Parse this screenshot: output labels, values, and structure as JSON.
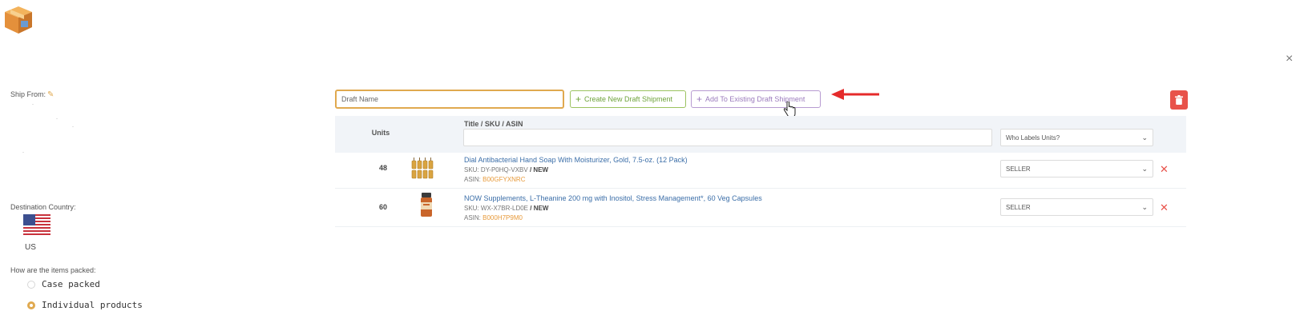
{
  "window": {
    "close_symbol": "×"
  },
  "left_panel": {
    "ship_from_label": "Ship From:",
    "destination_label": "Destination Country:",
    "country": "US",
    "packed_question": "How are the items packed:",
    "pack_options": [
      {
        "label": "Case packed",
        "selected": false
      },
      {
        "label": "Individual products",
        "selected": true
      }
    ]
  },
  "toolbar": {
    "draft_name_placeholder": "Draft Name",
    "create_label": "Create New Draft Shipment",
    "add_existing_label": "Add To Existing Draft Shipment",
    "plus": "+"
  },
  "table": {
    "headers": {
      "units": "Units",
      "title": "Title / SKU / ASIN"
    },
    "who_labels_placeholder": "Who Labels Units?",
    "rows": [
      {
        "units": "48",
        "title": "Dial Antibacterial Hand Soap With Moisturizer, Gold, 7.5-oz. (12 Pack)",
        "sku_prefix": "SKU: DY-P0HQ-VXBV",
        "condition": "/ NEW",
        "asin_prefix": "ASIN:",
        "asin": "B00GFYXNRC",
        "labels": "SELLER",
        "remove": "✕"
      },
      {
        "units": "60",
        "title": "NOW Supplements, L-Theanine 200 mg with Inositol, Stress Management*, 60 Veg Capsules",
        "sku_prefix": "SKU: WX-X7BR-LD0E",
        "condition": "/ NEW",
        "asin_prefix": "ASIN:",
        "asin": "B000H7P9M0",
        "labels": "SELLER",
        "remove": "✕"
      }
    ]
  },
  "icons": [
    "box-logo-icon",
    "pencil-icon",
    "us-flag-icon",
    "trash-icon",
    "chevron-down-icon",
    "hand-cursor-icon",
    "red-arrow-icon"
  ],
  "colors": {
    "accent": "#e0a94f",
    "green": "#6ea33a",
    "purple": "#9b7bbd",
    "danger": "#e8524a",
    "link": "#3b6ea8",
    "asin": "#e79a3a"
  }
}
